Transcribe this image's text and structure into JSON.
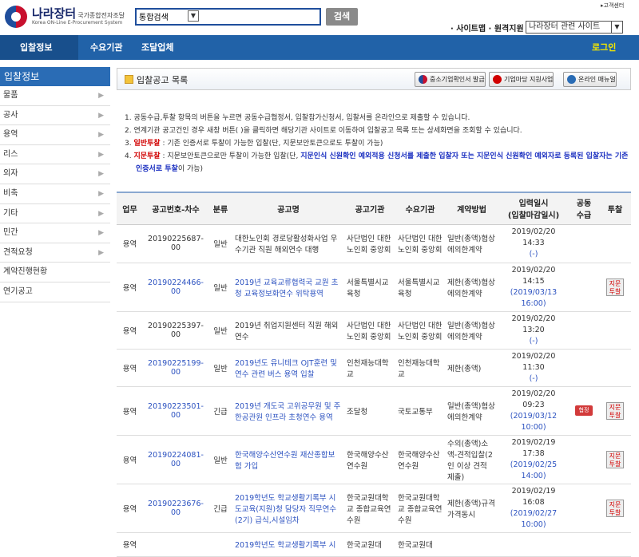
{
  "header": {
    "logo_title": "나라장터",
    "logo_subtitle": "국가종합전자조달",
    "logo_english": "Korea ON-Line E-Procurement System",
    "search_select": "통합검색",
    "search_button": "검색",
    "customer_center": "고객센터",
    "util_links": "· 사이트맵 · 원격지원",
    "related_sites": "나라장터 관련 사이트"
  },
  "gnb": {
    "items": [
      "입찰정보",
      "수요기관",
      "조달업체"
    ],
    "login": "로그인"
  },
  "sidebar": {
    "title": "입찰정보",
    "items": [
      "물품",
      "공사",
      "용역",
      "리스",
      "외자",
      "비축",
      "기타",
      "민간",
      "견적요청",
      "계약진행현황",
      "연기공고"
    ]
  },
  "page": {
    "title": "입찰공고 목록",
    "buttons": [
      "중소기업확인서 발급",
      "기업마당 지원사업",
      "온라인 매뉴얼"
    ]
  },
  "notes": {
    "n1": "1.  공동수급,투찰 항목의 버튼을 누르면 공동수급협정서, 입찰참가신청서, 입찰서를 온라인으로 제출할 수 있습니다.",
    "n2": "2.  연계기관 공고건인 경우 새창 버튼(     )을 클릭하면 해당기관 사이트로 이동하여 입찰공고 목록 또는 상세화면을 조회할 수 있습니다.",
    "n3_prefix": "3.  ",
    "n3_label": "일반투찰",
    "n3_text": " : 기존 인증서로 투찰이 가능한 입찰(단, 지문보안토큰으로도 투찰이 가능)",
    "n4_prefix": "4.  ",
    "n4_label": "지문투찰",
    "n4_text": " : 지문보안토큰으로만 투찰이 가능한 입찰(단, ",
    "n4_blue": "지문인식 신원확인 예외적용 신청서를 제출한 입찰자 또는 지문인식 신원확인 예외자로 등록된 입찰자는 기존 인증서로 투찰",
    "n4_tail": "이 가능)"
  },
  "table": {
    "headers": [
      "업무",
      "공고번호-차수",
      "분류",
      "공고명",
      "공고기관",
      "수요기관",
      "계약방법",
      "입력일시\n(입찰마감일시)",
      "공동\n수급",
      "투찰"
    ],
    "rows": [
      {
        "type": "용역",
        "no": "20190225687-00",
        "cat": "일반",
        "name": "대한노인회 경로당활성화사업 우수기관 직원 해외연수 대행",
        "org": "사단법인 대한노인회 중앙회",
        "demand": "사단법인 대한노인회 중앙회",
        "method": "일반(총액)협상에의한계약",
        "date": "2019/02/20 14:33",
        "deadline": "(-)",
        "joint": "",
        "bid": ""
      },
      {
        "type": "용역",
        "no": "20190224466-00",
        "cat": "일반",
        "name": "2019년 교육교류협력국 교원 초청 교육정보화연수 위탁용역",
        "org": "서울특별시교육청",
        "demand": "서울특별시교육청",
        "method": "제한(총액)협상에의한계약",
        "date": "2019/02/20 14:15",
        "deadline": "(2019/03/13 16:00)",
        "joint": "",
        "bid": "지문\n투찰"
      },
      {
        "type": "용역",
        "no": "20190225397-00",
        "cat": "일반",
        "name": "2019년 취업지원센터 직원 해외연수",
        "org": "사단법인 대한노인회 중앙회",
        "demand": "사단법인 대한노인회 중앙회",
        "method": "일반(총액)협상에의한계약",
        "date": "2019/02/20 13:20",
        "deadline": "(-)",
        "joint": "",
        "bid": ""
      },
      {
        "type": "용역",
        "no": "20190225199-00",
        "cat": "일반",
        "name": "2019년도 유니테크 OJT훈련 및 연수 관련 버스 용역 입찰",
        "org": "인천재능대학교",
        "demand": "인천재능대학교",
        "method": "제한(총액)",
        "date": "2019/02/20 11:30",
        "deadline": "(-)",
        "joint": "",
        "bid": ""
      },
      {
        "type": "용역",
        "no": "20190223501-00",
        "cat": "긴급",
        "name": "2019년 개도국 고위공무원 및 주한공관원 인프라 초청연수 용역",
        "org": "조달청",
        "demand": "국토교통부",
        "method": "일반(총액)협상에의한계약",
        "date": "2019/02/20 09:23",
        "deadline": "(2019/03/12 10:00)",
        "joint": "협정",
        "bid": "지문\n투찰"
      },
      {
        "type": "용역",
        "no": "20190224081-00",
        "cat": "일반",
        "name": "한국해양수산연수원 재산종합보험 가입",
        "org": "한국해양수산연수원",
        "demand": "한국해양수산연수원",
        "method": "수의(총액)소액-견적입찰(2인 이상 견적 제출)",
        "date": "2019/02/19 17:38",
        "deadline": "(2019/02/25 14:00)",
        "joint": "",
        "bid": "지문\n투찰"
      },
      {
        "type": "용역",
        "no": "20190223676-00",
        "cat": "긴급",
        "name": "2019학년도 학교생활기록부 시도교육(지원)청 담당자 직무연수(2기) 급식,시설임차",
        "org": "한국교원대학교 종합교육연수원",
        "demand": "한국교원대학교 종합교육연수원",
        "method": "제한(총액)규격가격동시",
        "date": "2019/02/19 16:08",
        "deadline": "(2019/02/27 10:00)",
        "joint": "",
        "bid": "지문\n투찰"
      },
      {
        "type": "용역",
        "no": "",
        "cat": "",
        "name": "2019학년도 학교생활기록부 시",
        "org": "한국교원대",
        "demand": "한국교원대",
        "method": "",
        "date": "",
        "deadline": "",
        "joint": "",
        "bid": ""
      }
    ]
  }
}
